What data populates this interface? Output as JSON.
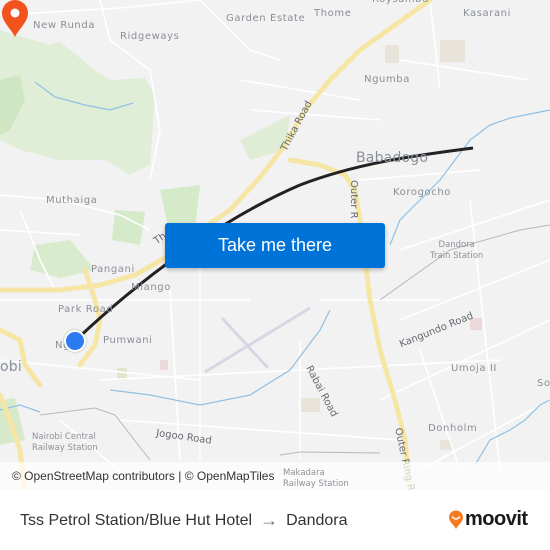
{
  "map": {
    "places": [
      {
        "id": "new-runda",
        "label": "New Runda"
      },
      {
        "id": "ridgeways",
        "label": "Ridgeways"
      },
      {
        "id": "garden-estate",
        "label": "Garden Estate"
      },
      {
        "id": "thome",
        "label": "Thome"
      },
      {
        "id": "roysambu",
        "label": "Roysambu"
      },
      {
        "id": "kasarani",
        "label": "Kasarani"
      },
      {
        "id": "ngumba",
        "label": "Ngumba"
      },
      {
        "id": "babadogo",
        "label": "Babadogo"
      },
      {
        "id": "korogocho",
        "label": "Korogocho"
      },
      {
        "id": "muthaiga",
        "label": "Muthaiga"
      },
      {
        "id": "pangani",
        "label": "Pangani"
      },
      {
        "id": "park-road",
        "label": "Park Road"
      },
      {
        "id": "mlango",
        "label": "Mlango"
      },
      {
        "id": "pumwani",
        "label": "Pumwani"
      },
      {
        "id": "ngara",
        "label": "Ng"
      },
      {
        "id": "nairobi",
        "label": "obi"
      },
      {
        "id": "umoja-ii",
        "label": "Umoja II"
      },
      {
        "id": "soweto",
        "label": "So"
      },
      {
        "id": "donholm",
        "label": "Donholm"
      }
    ],
    "roads": [
      {
        "id": "thika-road-north",
        "label": "Thika Road"
      },
      {
        "id": "thika-road-south",
        "label": "Th"
      },
      {
        "id": "outer-ring-north",
        "label": "Outer R"
      },
      {
        "id": "outer-ring-south",
        "label": "Outer Ring R"
      },
      {
        "id": "kangundo-road",
        "label": "Kangundo Road"
      },
      {
        "id": "rabai-road",
        "label": "Rabai Road"
      },
      {
        "id": "jogoo-road",
        "label": "Jogoo Road"
      }
    ],
    "stations": [
      {
        "id": "dandora-train",
        "line1": "Dandora",
        "line2": "Train Station"
      },
      {
        "id": "nairobi-central",
        "line1": "Nairobi Central",
        "line2": "Railway Station"
      },
      {
        "id": "makadara",
        "line1": "Makadara",
        "line2": "Railway Station"
      }
    ],
    "markers": {
      "origin": {
        "name": "Tss Petrol Station/Blue Hut Hotel",
        "color": "#2d7bf0"
      },
      "destination": {
        "name": "Dandora",
        "color": "#f2521b"
      }
    },
    "route_color": "#222222",
    "cta_label": "Take me there",
    "cta_color": "#0073d9",
    "attribution": "© OpenStreetMap contributors | © OpenMapTiles"
  },
  "footer": {
    "origin": "Tss Petrol Station/Blue Hut Hotel",
    "arrow": "→",
    "destination": "Dandora",
    "brand": "moovit",
    "brand_color": "#f47b20"
  }
}
